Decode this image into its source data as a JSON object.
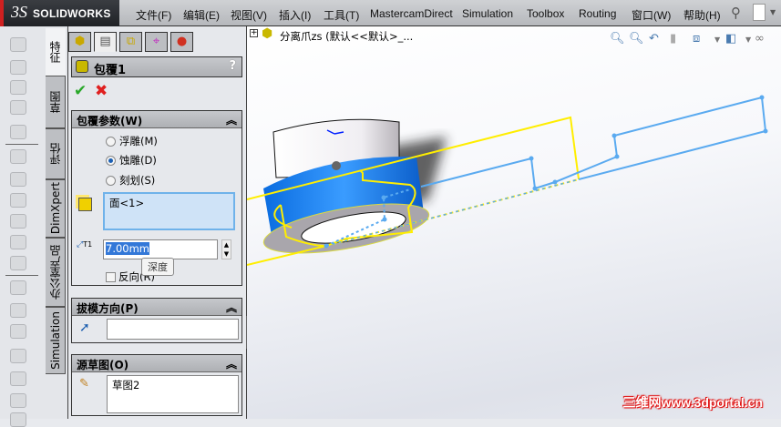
{
  "app": {
    "brand": "SOLIDWORKS",
    "brand_prefix": "3S"
  },
  "menu": [
    "文件(F)",
    "编辑(E)",
    "视图(V)",
    "插入(I)",
    "工具(T)",
    "MastercamDirect",
    "Simulation",
    "Toolbox",
    "Routing",
    "窗口(W)",
    "帮助(H)"
  ],
  "side_tabs": [
    "特征",
    "草图",
    "评估",
    "DimXpert",
    "办公室产品",
    "Simulation"
  ],
  "panel": {
    "title": "包覆1",
    "help": "?",
    "ok_icon": "check-icon",
    "cancel_icon": "x-icon",
    "params": {
      "header": "包覆参数(W)",
      "options": [
        {
          "label": "浮雕(M)",
          "selected": false
        },
        {
          "label": "蚀雕(D)",
          "selected": true
        },
        {
          "label": "刻划(S)",
          "selected": false
        }
      ],
      "face_list": "面<1>",
      "depth_value": "7.00mm",
      "depth_icon_label": "T1",
      "tooltip": "深度",
      "reverse_label": "反向(R)",
      "reverse_checked": false
    },
    "draft": {
      "header": "拔模方向(P)",
      "value": ""
    },
    "source": {
      "header": "源草图(O)",
      "value": "草图2"
    }
  },
  "tree": {
    "root": "分离爪zs  (默认<<默认>_..."
  },
  "watermark": "三维网www.3dportal.cn",
  "colors": {
    "accent": "#1e7fe8",
    "sketch_yellow": "#ffee00",
    "sketch_blue": "#5aaaf0",
    "watermark": "#e01818"
  }
}
